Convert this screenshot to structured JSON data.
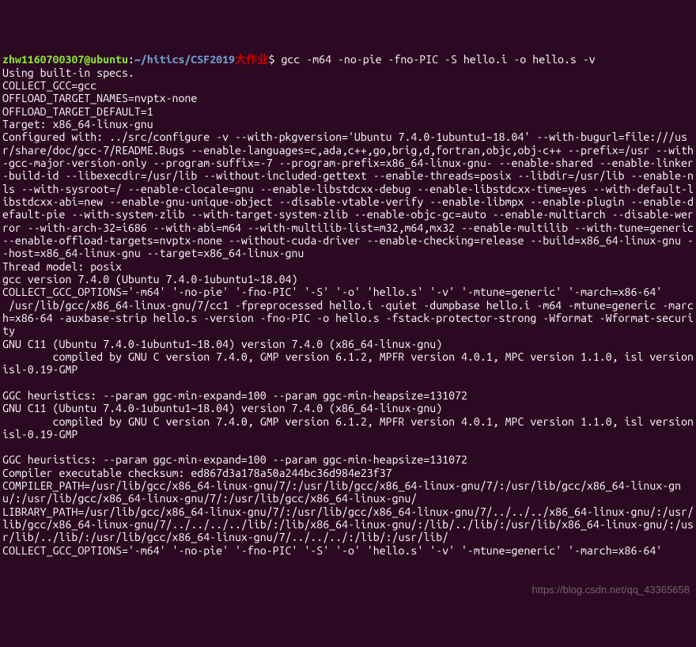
{
  "prompt": {
    "user_host": "zhw1160700307@ubuntu",
    "colon": ":",
    "cwd_prefix": "~/hitics/CSF2019",
    "cwd_cjk": "大作业",
    "dollar": "$ ",
    "command": "gcc -m64 -no-pie -fno-PIC -S hello.i -o hello.s -v"
  },
  "output": "Using built-in specs.\nCOLLECT_GCC=gcc\nOFFLOAD_TARGET_NAMES=nvptx-none\nOFFLOAD_TARGET_DEFAULT=1\nTarget: x86_64-linux-gnu\nConfigured with: ../src/configure -v --with-pkgversion='Ubuntu 7.4.0-1ubuntu1~18.04' --with-bugurl=file:///usr/share/doc/gcc-7/README.Bugs --enable-languages=c,ada,c++,go,brig,d,fortran,objc,obj-c++ --prefix=/usr --with-gcc-major-version-only --program-suffix=-7 --program-prefix=x86_64-linux-gnu- --enable-shared --enable-linker-build-id --libexecdir=/usr/lib --without-included-gettext --enable-threads=posix --libdir=/usr/lib --enable-nls --with-sysroot=/ --enable-clocale=gnu --enable-libstdcxx-debug --enable-libstdcxx-time=yes --with-default-libstdcxx-abi=new --enable-gnu-unique-object --disable-vtable-verify --enable-libmpx --enable-plugin --enable-default-pie --with-system-zlib --with-target-system-zlib --enable-objc-gc=auto --enable-multiarch --disable-werror --with-arch-32=i686 --with-abi=m64 --with-multilib-list=m32,m64,mx32 --enable-multilib --with-tune=generic --enable-offload-targets=nvptx-none --without-cuda-driver --enable-checking=release --build=x86_64-linux-gnu --host=x86_64-linux-gnu --target=x86_64-linux-gnu\nThread model: posix\ngcc version 7.4.0 (Ubuntu 7.4.0-1ubuntu1~18.04)\nCOLLECT_GCC_OPTIONS='-m64' '-no-pie' '-fno-PIC' '-S' '-o' 'hello.s' '-v' '-mtune=generic' '-march=x86-64'\n /usr/lib/gcc/x86_64-linux-gnu/7/cc1 -fpreprocessed hello.i -quiet -dumpbase hello.i -m64 -mtune=generic -march=x86-64 -auxbase-strip hello.s -version -fno-PIC -o hello.s -fstack-protector-strong -Wformat -Wformat-security\nGNU C11 (Ubuntu 7.4.0-1ubuntu1~18.04) version 7.4.0 (x86_64-linux-gnu)\n        compiled by GNU C version 7.4.0, GMP version 6.1.2, MPFR version 4.0.1, MPC version 1.1.0, isl version isl-0.19-GMP\n\nGGC heuristics: --param ggc-min-expand=100 --param ggc-min-heapsize=131072\nGNU C11 (Ubuntu 7.4.0-1ubuntu1~18.04) version 7.4.0 (x86_64-linux-gnu)\n        compiled by GNU C version 7.4.0, GMP version 6.1.2, MPFR version 4.0.1, MPC version 1.1.0, isl version isl-0.19-GMP\n\nGGC heuristics: --param ggc-min-expand=100 --param ggc-min-heapsize=131072\nCompiler executable checksum: ed867d3a178a50a244bc36d984e23f37\nCOMPILER_PATH=/usr/lib/gcc/x86_64-linux-gnu/7/:/usr/lib/gcc/x86_64-linux-gnu/7/:/usr/lib/gcc/x86_64-linux-gnu/:/usr/lib/gcc/x86_64-linux-gnu/7/:/usr/lib/gcc/x86_64-linux-gnu/\nLIBRARY_PATH=/usr/lib/gcc/x86_64-linux-gnu/7/:/usr/lib/gcc/x86_64-linux-gnu/7/../../../x86_64-linux-gnu/:/usr/lib/gcc/x86_64-linux-gnu/7/../../../../lib/:/lib/x86_64-linux-gnu/:/lib/../lib/:/usr/lib/x86_64-linux-gnu/:/usr/lib/../lib/:/usr/lib/gcc/x86_64-linux-gnu/7/../../../:/lib/:/usr/lib/\nCOLLECT_GCC_OPTIONS='-m64' '-no-pie' '-fno-PIC' '-S' '-o' 'hello.s' '-v' '-mtune=generic' '-march=x86-64'",
  "watermark": "https://blog.csdn.net/qq_43365658"
}
